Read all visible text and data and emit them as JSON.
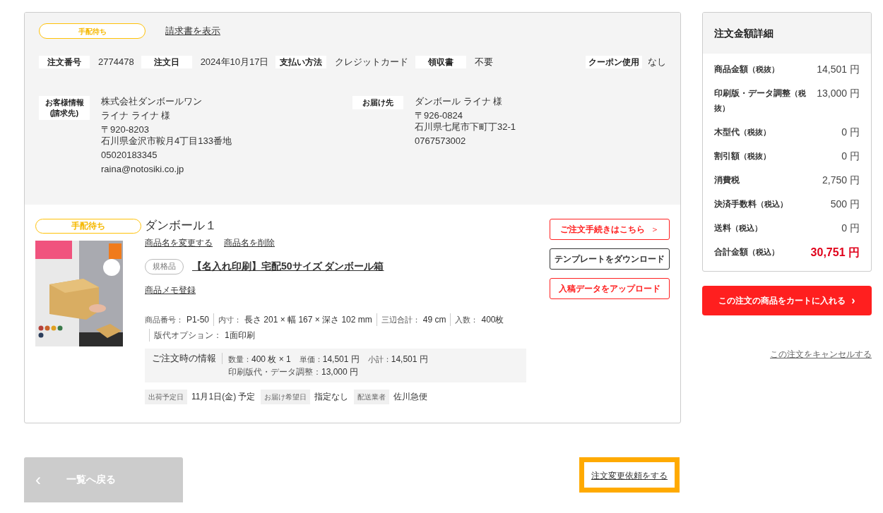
{
  "header": {
    "status": "手配待ち",
    "invoice_link": "請求書を表示"
  },
  "order_fields": [
    {
      "label": "注文番号",
      "value": "2774478"
    },
    {
      "label": "注文日",
      "value": "2024年10月17日"
    },
    {
      "label": "支払い方法",
      "value": "クレジットカード"
    },
    {
      "label": "領収書",
      "value": "不要"
    }
  ],
  "coupon": {
    "label": "クーポン使用",
    "value": "なし"
  },
  "customer": {
    "label_lines": [
      "お客様情報",
      "(請求先)"
    ],
    "blocks": [
      [
        "株式会社ダンボールワン"
      ],
      [
        "ライナ ライナ 様"
      ],
      [
        "〒920-8203",
        "石川県金沢市鞍月4丁目133番地"
      ],
      [
        "05020183345"
      ],
      [
        "raina@notosiki.co.jp"
      ]
    ]
  },
  "delivery": {
    "label_lines": [
      "お届け先"
    ],
    "blocks": [
      [
        "ダンボール ライナ 様"
      ],
      [
        "〒926-0824",
        "石川県七尾市下町丁32-1"
      ],
      [
        "0767573002"
      ]
    ]
  },
  "product": {
    "status": "手配待ち",
    "name": "ダンボール１",
    "rename_link": "商品名を変更する",
    "delete_link": "商品名を削除",
    "tag": "規格品",
    "title": "【名入れ印刷】宅配50サイズ ダンボール箱",
    "memo_link": "商品メモ登録",
    "specs": [
      {
        "label": "商品番号：",
        "value": "P1-50"
      },
      {
        "label": "内寸：",
        "value": "長さ 201 × 幅 167 × 深さ 102 mm"
      },
      {
        "label": "三辺合計：",
        "value": "49 cm"
      },
      {
        "label": "入数：",
        "value": "400枚"
      }
    ],
    "specs_2": [
      {
        "label": "版代オプション：",
        "value": "1面印刷"
      }
    ],
    "order_info": {
      "title": "ご注文時の情報",
      "items": [
        {
          "label": "数量：",
          "value": "400 枚 × 1"
        },
        {
          "label": "単価：",
          "value": "14,501 円"
        },
        {
          "label": "小計：",
          "value": "14,501 円"
        }
      ],
      "line_2": {
        "label": "印刷版代・データ調整：",
        "value": "13,000 円"
      }
    },
    "shipping": [
      {
        "label": "出荷予定日",
        "value": "11月1日(金) 予定"
      },
      {
        "label": "お届け希望日",
        "value": "指定なし"
      },
      {
        "label": "配送業者",
        "value": "佐川急便"
      }
    ],
    "buttons": [
      {
        "label": "ご注文手続きはこちら",
        "kind": "primary",
        "arrow": "＞"
      },
      {
        "label": "テンプレートをダウンロード",
        "kind": "neutral"
      },
      {
        "label": "入稿データをアップロード",
        "kind": "primary"
      }
    ]
  },
  "summary": {
    "title": "注文金額詳細",
    "rows": [
      {
        "label": "商品金額",
        "note": "（税抜）",
        "value": "14,501 円",
        "kind": "normal"
      },
      {
        "label": "印刷版・データ調整",
        "note": "（税抜）",
        "value": "13,000 円",
        "kind": "normal"
      },
      {
        "label": "木型代",
        "note": "（税抜）",
        "value": "0 円",
        "kind": "normal"
      },
      {
        "label": "割引額",
        "note": "（税抜）",
        "value": "0 円",
        "kind": "normal"
      },
      {
        "label": "消費税",
        "value": "2,750 円",
        "kind": "normal"
      },
      {
        "label": "決済手数料",
        "note": "（税込）",
        "value": "500 円",
        "kind": "normal"
      },
      {
        "label": "送料",
        "note": "（税込）",
        "value": "0 円",
        "kind": "normal"
      },
      {
        "label": "合計金額",
        "note": "（税込）",
        "value": "30,751 円",
        "kind": "total"
      }
    ],
    "cart_button": "この注文の商品をカートに入れる",
    "cart_arrow": "›",
    "cancel_link": "この注文をキャンセルする"
  },
  "footer": {
    "back_arrow": "‹",
    "back_button": "一覧へ戻る",
    "change_request": "注文変更依頼をする"
  }
}
